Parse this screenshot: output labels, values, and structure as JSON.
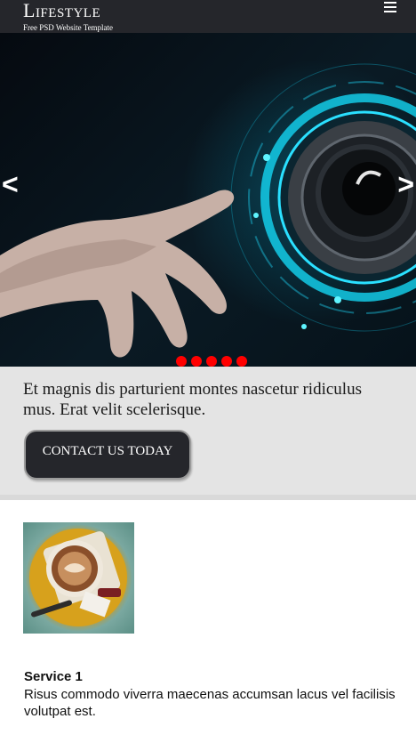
{
  "header": {
    "logo": "Lifestyle",
    "tagline": "Free PSD Website Template",
    "menu_icon": "hamburger-menu-icon"
  },
  "hero": {
    "image": "hand-touching-digital-lens",
    "prev_label": "<",
    "next_label": ">",
    "dot_count": 5,
    "dot_color": "#ff0000"
  },
  "callout": {
    "text": "Et magnis dis parturient montes nascetur ridiculus mus. Erat velit scelerisque.",
    "button_label": "CONTACT US TODAY"
  },
  "service": {
    "image": "coffee-cup",
    "title": "Service 1",
    "description": "Risus commodo viverra maecenas accumsan lacus vel facilisis volutpat est."
  },
  "colors": {
    "header_bg": "#25262b",
    "callout_bg": "#e4e4e4",
    "button_bg": "#25262b"
  }
}
